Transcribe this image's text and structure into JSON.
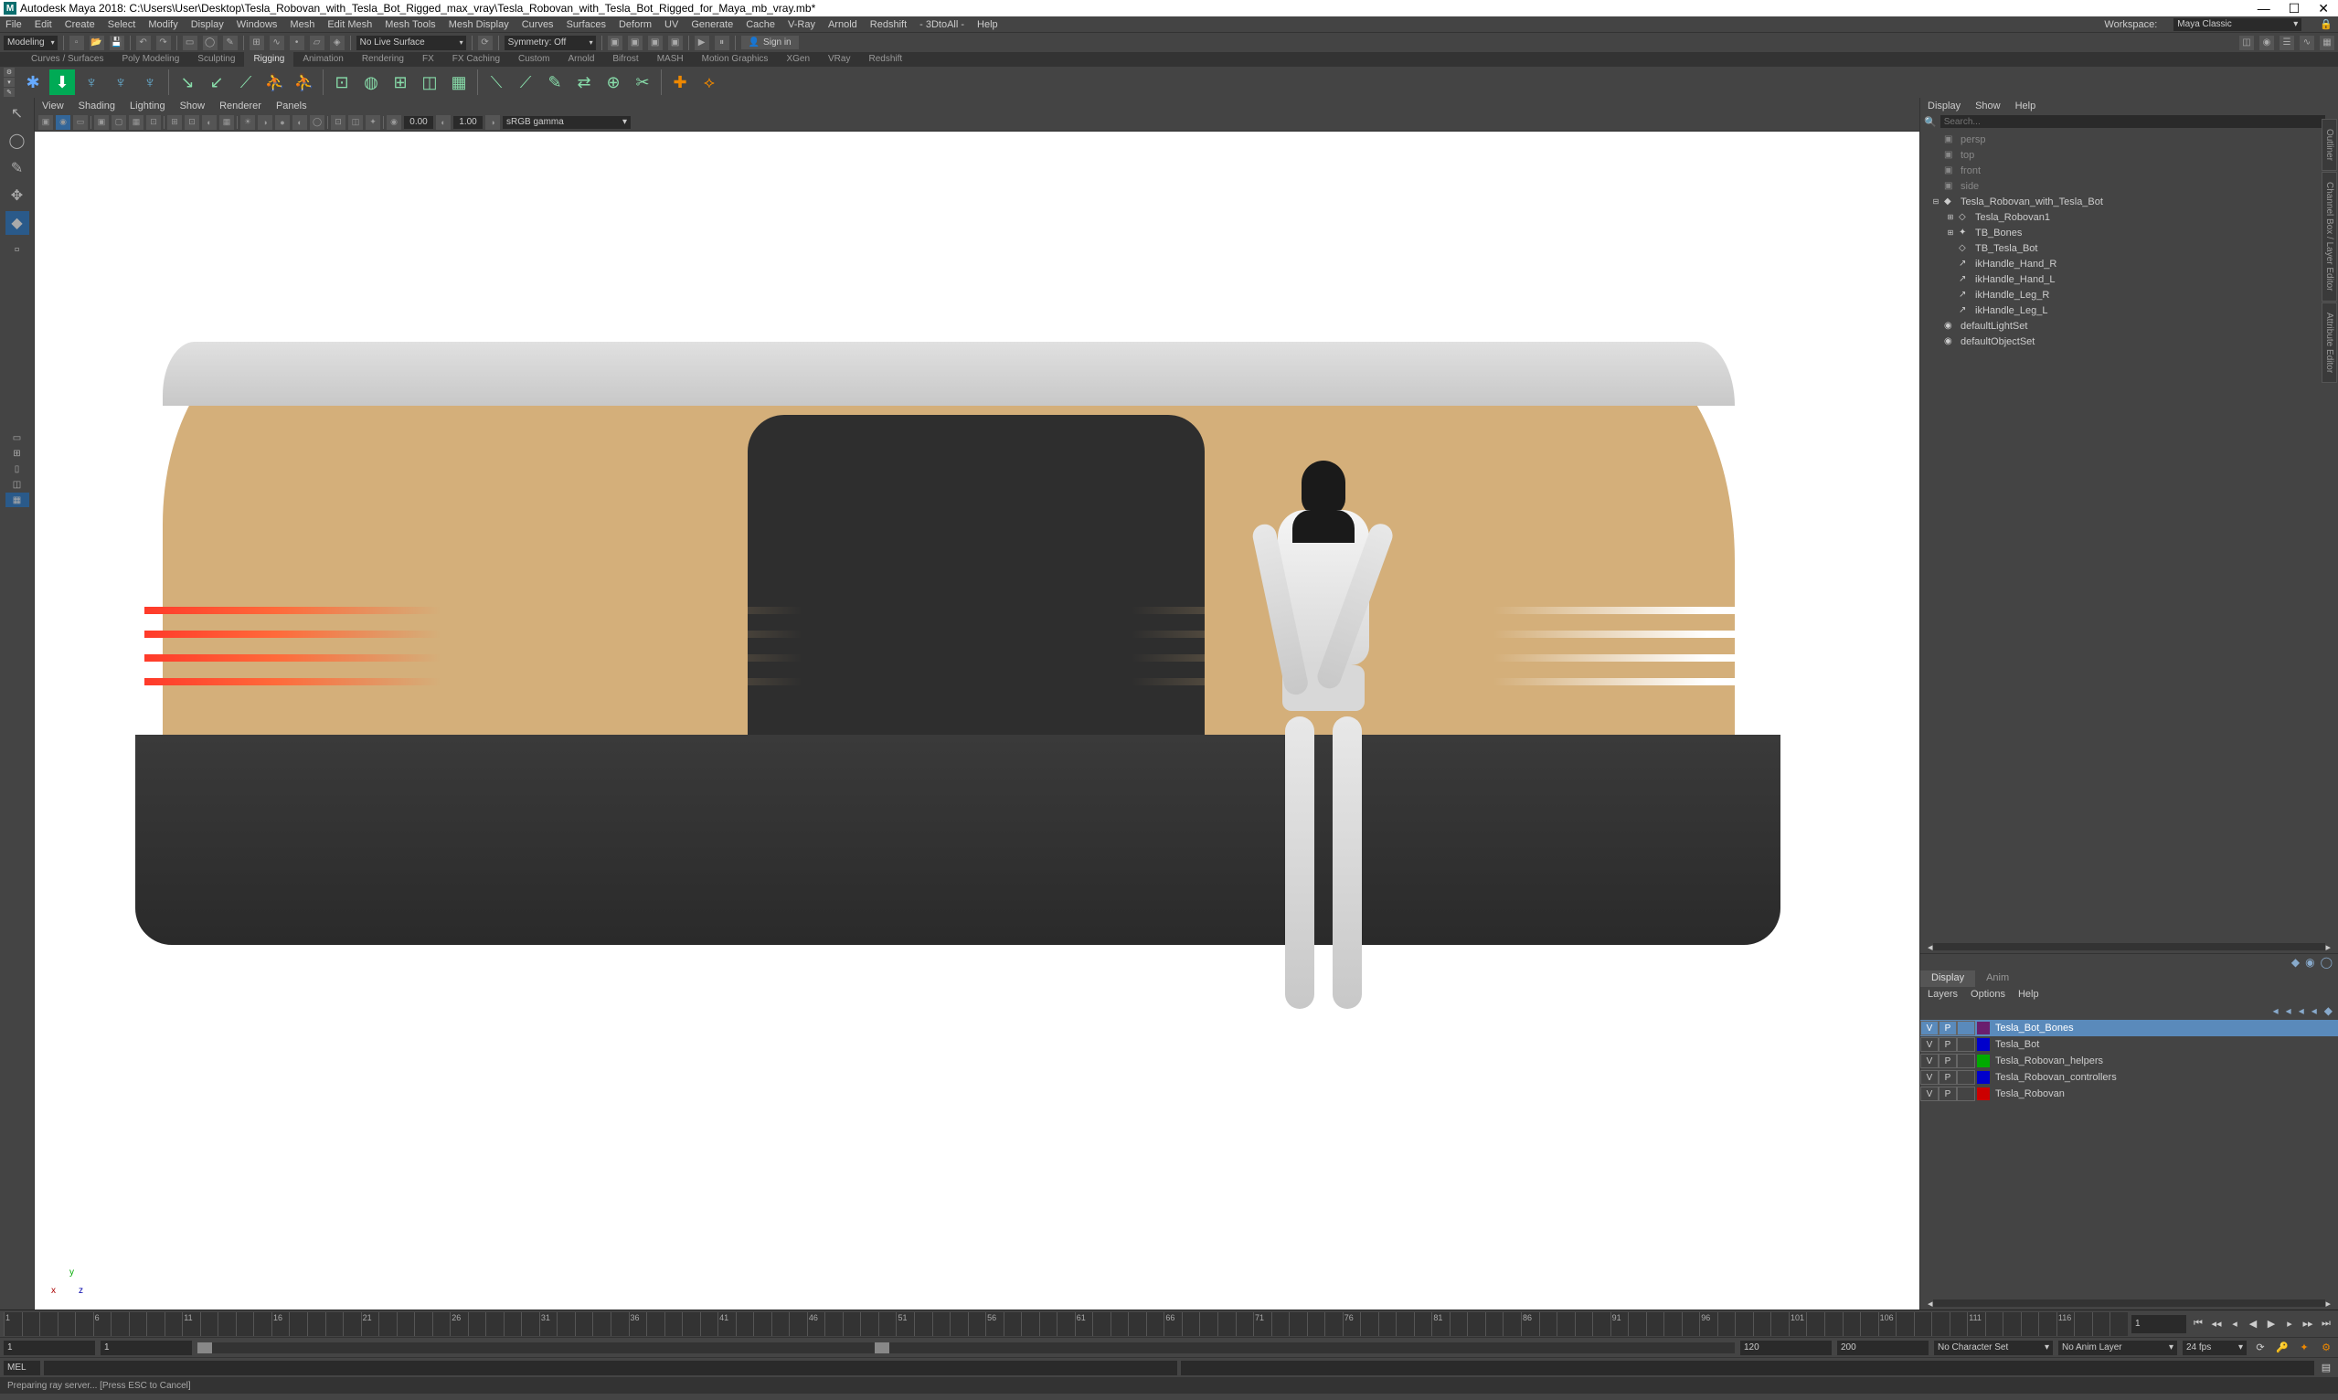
{
  "title": "Autodesk Maya 2018: C:\\Users\\User\\Desktop\\Tesla_Robovan_with_Tesla_Bot_Rigged_max_vray\\Tesla_Robovan_with_Tesla_Bot_Rigged_for_Maya_mb_vray.mb*",
  "menubar": [
    "File",
    "Edit",
    "Create",
    "Select",
    "Modify",
    "Display",
    "Windows",
    "Mesh",
    "Edit Mesh",
    "Mesh Tools",
    "Mesh Display",
    "Curves",
    "Surfaces",
    "Deform",
    "UV",
    "Generate",
    "Cache",
    "V-Ray",
    "Arnold",
    "Redshift",
    "- 3DtoAll -",
    "Help"
  ],
  "workspace_label": "Workspace:",
  "workspace_value": "Maya Classic",
  "mode_dd": "Modeling",
  "live_surface": "No Live Surface",
  "symmetry": "Symmetry: Off",
  "signin": "Sign in",
  "shelf_tabs": [
    "Curves / Surfaces",
    "Poly Modeling",
    "Sculpting",
    "Rigging",
    "Animation",
    "Rendering",
    "FX",
    "FX Caching",
    "Custom",
    "Arnold",
    "Bifrost",
    "MASH",
    "Motion Graphics",
    "XGen",
    "VRay",
    "Redshift"
  ],
  "active_shelf_tab": 3,
  "view_menu": [
    "View",
    "Shading",
    "Lighting",
    "Show",
    "Renderer",
    "Panels"
  ],
  "view_num1": "0.00",
  "view_num2": "1.00",
  "view_colorspace": "sRGB gamma",
  "outliner_menu": [
    "Display",
    "Show",
    "Help"
  ],
  "outliner_search": "",
  "outliner_search_ph": "Search...",
  "outliner": [
    {
      "icon": "▣",
      "name": "persp",
      "indent": 0,
      "dim": true
    },
    {
      "icon": "▣",
      "name": "top",
      "indent": 0,
      "dim": true
    },
    {
      "icon": "▣",
      "name": "front",
      "indent": 0,
      "dim": true
    },
    {
      "icon": "▣",
      "name": "side",
      "indent": 0,
      "dim": true
    },
    {
      "icon": "◆",
      "name": "Tesla_Robovan_with_Tesla_Bot",
      "indent": 0,
      "exp": "⊟"
    },
    {
      "icon": "◇",
      "name": "Tesla_Robovan1",
      "indent": 1,
      "exp": "⊞"
    },
    {
      "icon": "✦",
      "name": "TB_Bones",
      "indent": 1,
      "exp": "⊞"
    },
    {
      "icon": "◇",
      "name": "TB_Tesla_Bot",
      "indent": 1,
      "exp": ""
    },
    {
      "icon": "↗",
      "name": "ikHandle_Hand_R",
      "indent": 1,
      "exp": ""
    },
    {
      "icon": "↗",
      "name": "ikHandle_Hand_L",
      "indent": 1,
      "exp": ""
    },
    {
      "icon": "↗",
      "name": "ikHandle_Leg_R",
      "indent": 1,
      "exp": ""
    },
    {
      "icon": "↗",
      "name": "ikHandle_Leg_L",
      "indent": 1,
      "exp": ""
    },
    {
      "icon": "◉",
      "name": "defaultLightSet",
      "indent": 0
    },
    {
      "icon": "◉",
      "name": "defaultObjectSet",
      "indent": 0
    }
  ],
  "layers_tabs": [
    "Display",
    "Anim"
  ],
  "layers_submenu": [
    "Layers",
    "Options",
    "Help"
  ],
  "layers": [
    {
      "v": "V",
      "p": "P",
      "color": "#6a1e6e",
      "name": "Tesla_Bot_Bones",
      "selected": true
    },
    {
      "v": "V",
      "p": "P",
      "color": "#0000cc",
      "name": "Tesla_Bot"
    },
    {
      "v": "V",
      "p": "P",
      "color": "#00aa00",
      "name": "Tesla_Robovan_helpers"
    },
    {
      "v": "V",
      "p": "P",
      "color": "#0000cc",
      "name": "Tesla_Robovan_controllers"
    },
    {
      "v": "V",
      "p": "P",
      "color": "#cc0000",
      "name": "Tesla_Robovan"
    }
  ],
  "timeline": {
    "start": 1,
    "end": 120,
    "cur": 1
  },
  "range": {
    "a": "1",
    "b": "1",
    "c": "120",
    "d": "120",
    "e": "200"
  },
  "char_set": "No Character Set",
  "anim_layer": "No Anim Layer",
  "fps": "24 fps",
  "cmd_lang": "MEL",
  "status": "Preparing ray server... [Press ESC to Cancel]"
}
